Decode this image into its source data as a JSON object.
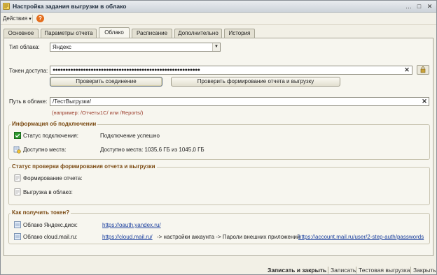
{
  "window": {
    "title": "Настройка задания выгрузки в облако",
    "controls": [
      "…",
      "□",
      "✕"
    ]
  },
  "menu": {
    "actions_label": "Действия",
    "actions_arrow": "▾",
    "help_label": "?"
  },
  "tabs": [
    {
      "label": "Основное",
      "active": false
    },
    {
      "label": "Параметры отчета",
      "active": false
    },
    {
      "label": "Облако",
      "active": true
    },
    {
      "label": "Расписание",
      "active": false
    },
    {
      "label": "Дополнительно",
      "active": false
    },
    {
      "label": "История",
      "active": false
    }
  ],
  "cloud": {
    "type_label": "Тип облака:",
    "type_value": "Яндекс",
    "token_label": "Токен доступа:",
    "token_value": "●●●●●●●●●●●●●●●●●●●●●●●●●●●●●●●●●●●●●●●●●●●●●●●●●●●●●●●●●●",
    "check_connection_label": "Проверить соединение",
    "check_report_label": "Проверить формирование отчета  и выгрузку",
    "path_label": "Путь в облаке:",
    "path_value": "/ТестВыгрузки/",
    "path_hint": "(например: /Отчеты1С/ или /Reports/)"
  },
  "connection_info": {
    "title": "Информация об подключении",
    "status_label": "Статус подключения:",
    "status_value": "Подключение успешно",
    "space_label": "Доступно места:",
    "space_value": "Доступно места: 1035,6 ГБ из 1045,0 ГБ"
  },
  "report_check": {
    "title": "Статус проверки формирования отчета и выгрузки",
    "formation_label": "Формирование отчета:",
    "upload_label": "Выгрузка в облако:"
  },
  "token_help": {
    "title": "Как получить токен?",
    "yandex_label": "Облако Яндекс.диск:",
    "yandex_link": "https://oauth.yandex.ru/",
    "mailru_label": "Облако cloud.mail.ru:",
    "mailru_link": "https://cloud.mail.ru/",
    "mailru_instructions": "-> настройки аккаунта -> Пароли внешних приложений",
    "mailru_link2": "https://account.mail.ru/user/2-step-auth/passwords"
  },
  "footer": {
    "save_close_label": "Записать и закрыть",
    "save_label": "Записать",
    "test_upload_label": "Тестовая выгрузка",
    "close_label": "Закрыть"
  },
  "colors": {
    "group_title": "#7a4a12",
    "hint": "#9a3b2a",
    "link": "#1a3f9e",
    "help_button": "#e46d1c"
  }
}
